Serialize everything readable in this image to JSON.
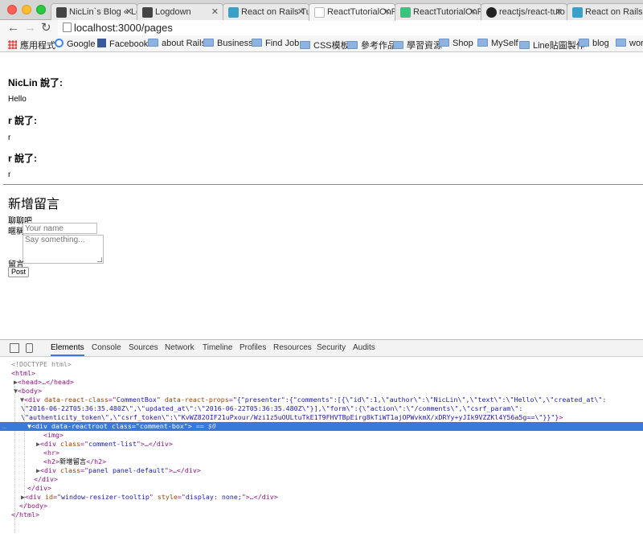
{
  "browser": {
    "tabs": [
      {
        "label": "NicLin`s Blog « Lo",
        "favicon_color": "#444444"
      },
      {
        "label": "Logdown",
        "favicon_color": "#444444"
      },
      {
        "label": "React on Rails Tuto",
        "favicon_color": "#3aa0c8"
      },
      {
        "label": "ReactTutorialOnRa",
        "favicon_color": "#ffffff"
      },
      {
        "label": "ReactTutorialOnRa",
        "favicon_color": "#3bc47d"
      },
      {
        "label": "reactjs/react-tuto",
        "favicon_color": "#222222"
      },
      {
        "label": "React on Rails Tuto",
        "favicon_color": "#3aa0c8"
      }
    ],
    "active_tab_index": 3,
    "url": "localhost:3000/pages",
    "bookmarks": [
      {
        "label": "應用程式",
        "icon": "apps-grid-icon"
      },
      {
        "label": "Google",
        "icon": "google-icon"
      },
      {
        "label": "Facebook",
        "icon": "facebook-icon"
      },
      {
        "label": "about Rails",
        "icon": "folder-icon"
      },
      {
        "label": "Business",
        "icon": "folder-icon"
      },
      {
        "label": "Find Job",
        "icon": "folder-icon"
      },
      {
        "label": "CSS模板",
        "icon": "folder-icon"
      },
      {
        "label": "參考作品",
        "icon": "folder-icon"
      },
      {
        "label": "學習資源",
        "icon": "folder-icon"
      },
      {
        "label": "Shop",
        "icon": "folder-icon"
      },
      {
        "label": "MySelf",
        "icon": "folder-icon"
      },
      {
        "label": "Line貼圖製作",
        "icon": "folder-icon"
      },
      {
        "label": "blog",
        "icon": "folder-icon"
      },
      {
        "label": "work",
        "icon": "folder-icon"
      }
    ]
  },
  "page": {
    "comments": [
      {
        "author": "NicLin",
        "suffix": " 說了:",
        "text": "Hello"
      },
      {
        "author": "r",
        "suffix": " 說了:",
        "text": "r"
      },
      {
        "author": "r",
        "suffix": " 說了:",
        "text": "r"
      }
    ],
    "form_title": "新增留言",
    "form_subtitle": "聊聊吧",
    "name_label": "暱稱",
    "name_placeholder": "Your name",
    "comment_label": "留言",
    "comment_placeholder": "Say something...",
    "submit_label": "Post"
  },
  "devtools": {
    "tabs": [
      "Elements",
      "Console",
      "Sources",
      "Network",
      "Timeline",
      "Profiles",
      "Resources",
      "Security",
      "Audits"
    ],
    "active_tab": "Elements",
    "lines": {
      "doctype": "<!DOCTYPE html>",
      "html_open": "<html>",
      "head": "<head>…</head>",
      "body_open": "<body>",
      "div_props_1": "\"{\"presenter\":{\"comments\":[{\\\"id\\\":1,\\\"author\\\":\\\"NicLin\\\",\\\"text\\\":\\\"Hello\\\",\\\"created_at\\\":",
      "div_props_2": "\\\"2016-06-22T05:36:35.480Z\\\",\\\"updated_at\\\":\\\"2016-06-22T05:36:35.480Z\\\"}],\\\"form\\\":{\\\"action\\\":\\\"/comments\\\",\\\"csrf_param\\\":",
      "div_props_3": "\\\"authenticity_token\\\",\\\"csrf_token\\\":\\\"KvWZ82OIF21uPxour/Wzi1z5uOULtuTkE1T9FHVTBpEirg8kTiWT1ajOPWvkmX/xDRYy+yJIk9VZZKl4Y56a5g==\\\"}}\"}",
      "selected_eq": "== $0",
      "img": "<img>",
      "comment_list": "<div class=\"comment-list\">…</div>",
      "hr": "<hr>",
      "h2_text": "新增留言",
      "panel": "<div class=\"panel panel-default\">…</div>",
      "div_close": "</div>",
      "tooltip": "<div id=\"window-resizer-tooltip\" style=\"display: none;\">…</div>",
      "body_close": "</body>",
      "html_close": "</html>"
    }
  }
}
